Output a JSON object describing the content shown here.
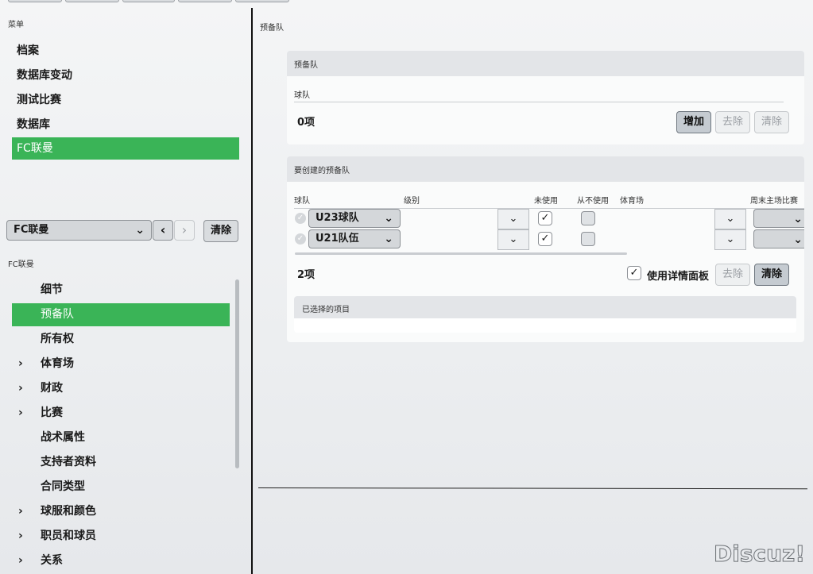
{
  "left": {
    "menu_label": "菜单",
    "menu_items": [
      {
        "label": "档案"
      },
      {
        "label": "数据库变动"
      },
      {
        "label": "测试比赛"
      },
      {
        "label": "数据库"
      },
      {
        "label": "FC联曼"
      }
    ],
    "club_select": "FC联曼",
    "clear_label": "清除",
    "nav_section_label": "FC联曼",
    "nav_items": [
      {
        "label": "细节",
        "arrow": ""
      },
      {
        "label": "预备队",
        "arrow": ""
      },
      {
        "label": "所有权",
        "arrow": ""
      },
      {
        "label": "体育场",
        "arrow": "›"
      },
      {
        "label": "财政",
        "arrow": "›"
      },
      {
        "label": "比赛",
        "arrow": "›"
      },
      {
        "label": "战术属性",
        "arrow": ""
      },
      {
        "label": "支持者资料",
        "arrow": ""
      },
      {
        "label": "合同类型",
        "arrow": ""
      },
      {
        "label": "球服和颜色",
        "arrow": "›"
      },
      {
        "label": "职员和球员",
        "arrow": "›"
      },
      {
        "label": "关系",
        "arrow": "›"
      }
    ]
  },
  "right": {
    "page_title": "预备队",
    "reserve_panel": {
      "title": "预备队",
      "column": "球队",
      "count": "0项",
      "add_label": "增加",
      "remove_label": "去除",
      "clear_label": "清除"
    },
    "create_panel": {
      "title": "要创建的预备队",
      "columns": {
        "team": "球队",
        "level": "级别",
        "unused": "未使用",
        "never_used": "从不使用",
        "stadium": "体育场",
        "weekend": "周末主场比赛"
      },
      "rows": [
        {
          "team": "U23球队",
          "unused_checked": "✓",
          "never_checked": ""
        },
        {
          "team": "U21队伍",
          "unused_checked": "✓",
          "never_checked": ""
        }
      ],
      "count": "2项",
      "detail_panel_label": "使用详情面板",
      "detail_checked": "✓",
      "remove_label": "去除",
      "clear_label": "清除",
      "selected_title": "已选择的项目"
    }
  },
  "watermark": "Discuz!",
  "colors": {
    "accent": "#3ab457",
    "panel_header": "#e3e5e8"
  }
}
